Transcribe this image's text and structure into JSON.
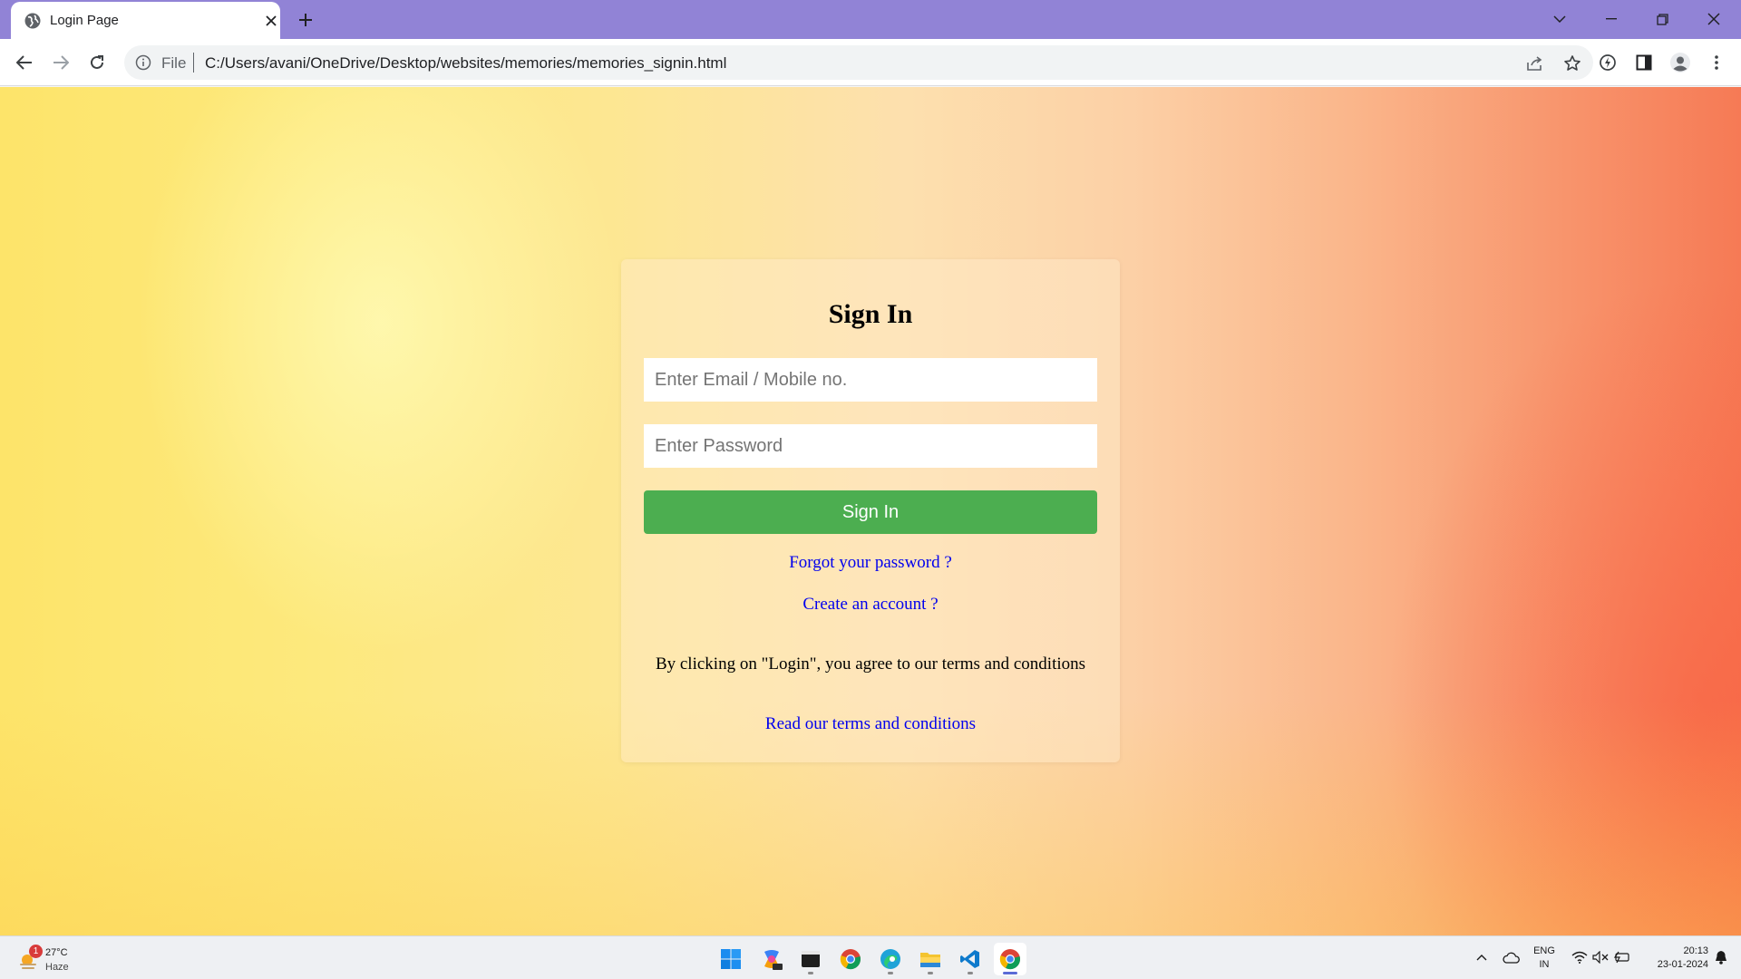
{
  "browser": {
    "tab": {
      "title": "Login Page"
    },
    "address": {
      "scheme": "File",
      "url": "C:/Users/avani/OneDrive/Desktop/websites/memories/memories_signin.html"
    }
  },
  "page": {
    "heading": "Sign In",
    "email_placeholder": "Enter Email / Mobile no.",
    "password_placeholder": "Enter Password",
    "signin_label": "Sign In",
    "forgot_link": "Forgot your password ?",
    "create_link": "Create an account ?",
    "terms_text": "By clicking on \"Login\", you agree to our terms and conditions",
    "read_terms_link": "Read our terms and conditions",
    "colors": {
      "button": "#4cae50",
      "link": "#0000ee"
    }
  },
  "taskbar": {
    "weather": {
      "badge": "1",
      "temperature": "27°C",
      "condition": "Haze"
    },
    "language": {
      "line1": "ENG",
      "line2": "IN"
    },
    "clock": {
      "time": "20:13",
      "date": "23-01-2024"
    },
    "apps": [
      "start-icon",
      "copilot-icon",
      "terminal-icon",
      "chrome-icon",
      "edge-icon",
      "file-explorer-icon",
      "vscode-icon",
      "chrome-active-icon"
    ]
  }
}
